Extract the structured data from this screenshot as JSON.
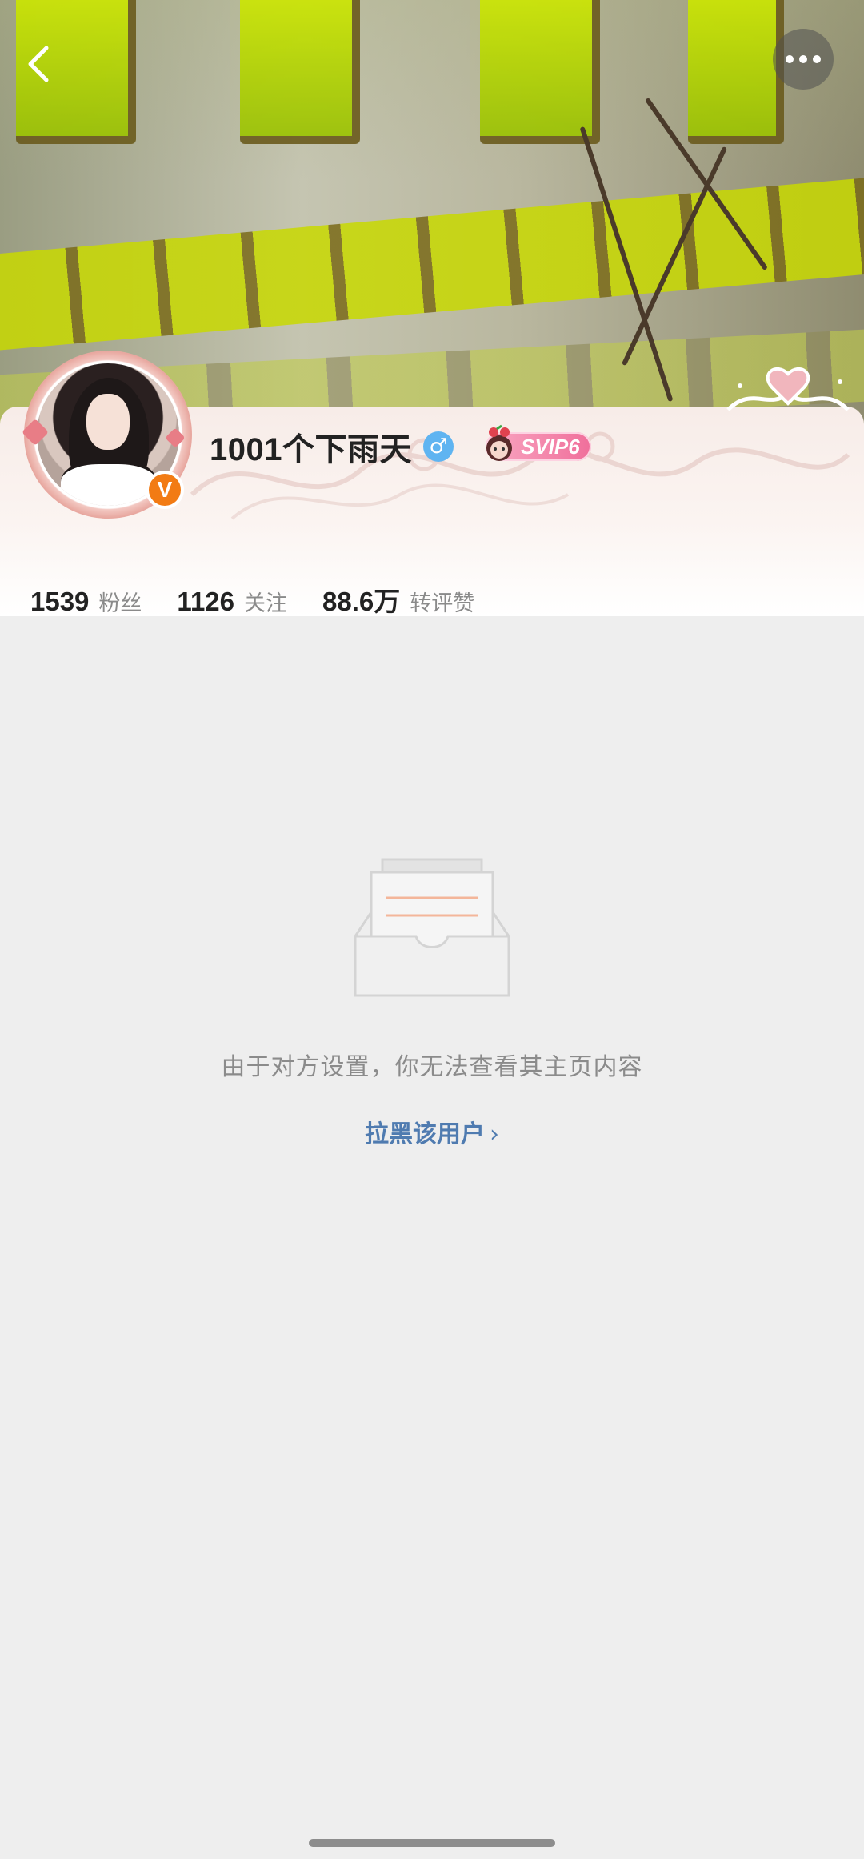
{
  "profile": {
    "username": "1001个下雨天",
    "verified_badge": "V",
    "gender_icon": "♂",
    "vip_badge": "SVIP6"
  },
  "stats": [
    {
      "value": "1539",
      "label": "粉丝"
    },
    {
      "value": "1126",
      "label": "关注"
    },
    {
      "value": "88.6万",
      "label": "转评赞"
    }
  ],
  "empty_state": {
    "message": "由于对方设置，你无法查看其主页内容",
    "block_link": "拉黑该用户",
    "block_link_chevron": "›"
  },
  "icons": {
    "back": "chevron-left-icon",
    "more": "more-horizontal-icon",
    "gender": "male-icon",
    "empty": "empty-inbox-icon"
  },
  "colors": {
    "accent_link": "#4f7bb0",
    "verified_orange": "#f27b14",
    "gender_blue": "#5fb4f1",
    "vip_pink": "#f06f9b",
    "background": "#eeeeee"
  }
}
